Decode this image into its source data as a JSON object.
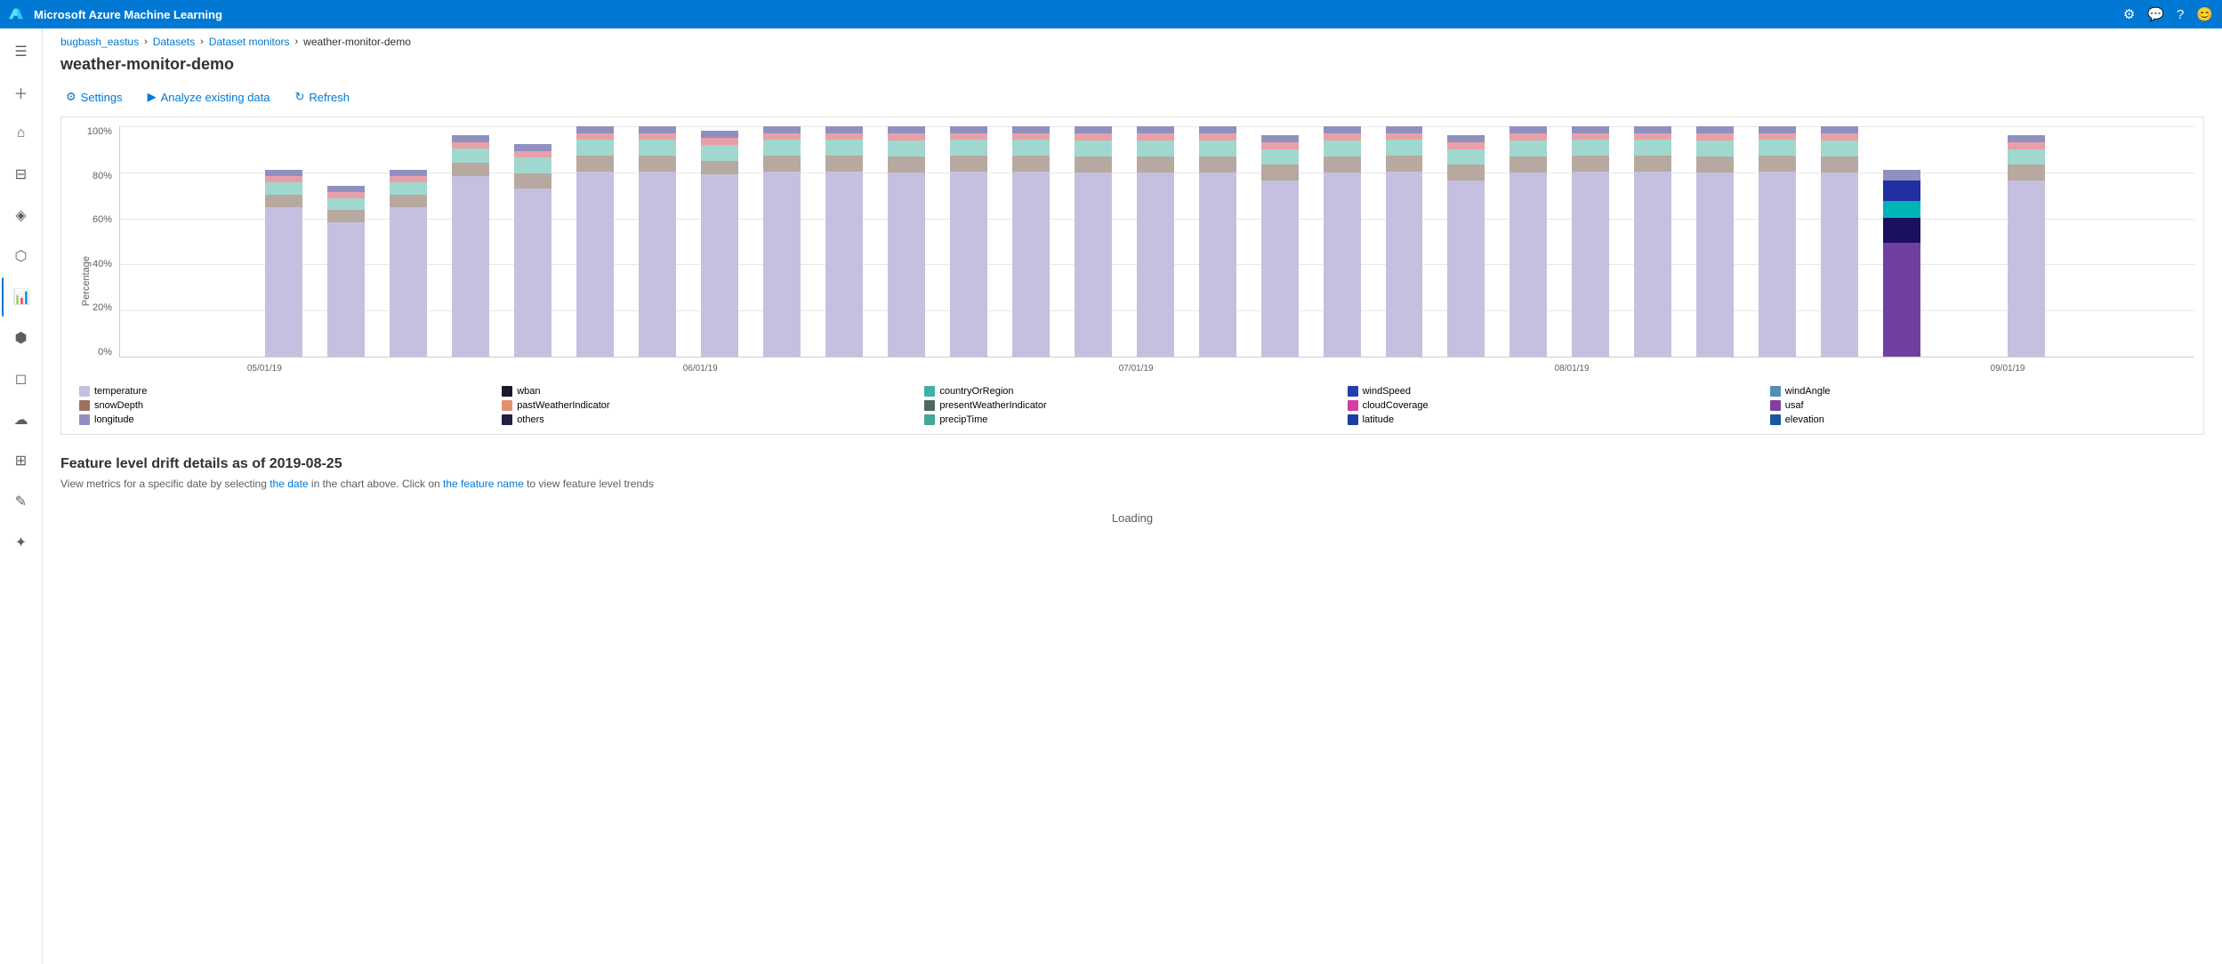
{
  "topbar": {
    "title": "Microsoft Azure Machine Learning",
    "icons": [
      "settings",
      "feedback",
      "help",
      "account"
    ]
  },
  "breadcrumb": {
    "items": [
      "bugbash_eastus",
      "Datasets",
      "Dataset monitors",
      "weather-monitor-demo"
    ]
  },
  "page": {
    "title": "weather-monitor-demo"
  },
  "toolbar": {
    "settings_label": "Settings",
    "analyze_label": "Analyze existing data",
    "refresh_label": "Refresh"
  },
  "chart": {
    "y_labels": [
      "100%",
      "80%",
      "60%",
      "40%",
      "20%",
      "0%"
    ],
    "y_axis_label": "Percentage",
    "x_labels": [
      "05/01/19",
      "06/01/19",
      "07/01/19",
      "08/01/19",
      "09/01/19"
    ],
    "bars": [
      {
        "x": 7,
        "segments": [
          {
            "color": "#c5c0e0",
            "h": 0.72
          },
          {
            "color": "#b8a9a0",
            "h": 0.06
          },
          {
            "color": "#a0d8cf",
            "h": 0.06
          },
          {
            "color": "#e8a0a8",
            "h": 0.03
          },
          {
            "color": "#9090c0",
            "h": 0.03
          }
        ]
      },
      {
        "x": 10,
        "segments": [
          {
            "color": "#c5c0e0",
            "h": 0.68
          },
          {
            "color": "#b8a9a0",
            "h": 0.06
          },
          {
            "color": "#a0d8cf",
            "h": 0.06
          },
          {
            "color": "#e8a0a8",
            "h": 0.03
          },
          {
            "color": "#9090c0",
            "h": 0.03
          }
        ]
      },
      {
        "x": 13,
        "segments": [
          {
            "color": "#c5c0e0",
            "h": 0.72
          },
          {
            "color": "#b8a9a0",
            "h": 0.06
          },
          {
            "color": "#a0d8cf",
            "h": 0.06
          },
          {
            "color": "#e8a0a8",
            "h": 0.03
          },
          {
            "color": "#9090c0",
            "h": 0.03
          }
        ]
      },
      {
        "x": 16,
        "segments": [
          {
            "color": "#c5c0e0",
            "h": 0.8
          },
          {
            "color": "#b8a9a0",
            "h": 0.06
          },
          {
            "color": "#a0d8cf",
            "h": 0.06
          },
          {
            "color": "#e8a0a8",
            "h": 0.03
          },
          {
            "color": "#9090c0",
            "h": 0.03
          }
        ]
      },
      {
        "x": 19,
        "segments": [
          {
            "color": "#c5c0e0",
            "h": 0.76
          },
          {
            "color": "#b8a9a0",
            "h": 0.07
          },
          {
            "color": "#a0d8cf",
            "h": 0.07
          },
          {
            "color": "#e8a0a8",
            "h": 0.03
          },
          {
            "color": "#9090c0",
            "h": 0.03
          }
        ]
      },
      {
        "x": 22,
        "segments": [
          {
            "color": "#c5c0e0",
            "h": 0.82
          },
          {
            "color": "#b8a9a0",
            "h": 0.07
          },
          {
            "color": "#a0d8cf",
            "h": 0.07
          },
          {
            "color": "#e8a0a8",
            "h": 0.03
          },
          {
            "color": "#9090c0",
            "h": 0.03
          }
        ]
      },
      {
        "x": 25,
        "segments": [
          {
            "color": "#c5c0e0",
            "h": 0.82
          },
          {
            "color": "#b8a9a0",
            "h": 0.07
          },
          {
            "color": "#a0d8cf",
            "h": 0.07
          },
          {
            "color": "#e8a0a8",
            "h": 0.03
          },
          {
            "color": "#9090c0",
            "h": 0.03
          }
        ]
      },
      {
        "x": 28,
        "segments": [
          {
            "color": "#c5c0e0",
            "h": 0.8
          },
          {
            "color": "#b8a9a0",
            "h": 0.06
          },
          {
            "color": "#a0d8cf",
            "h": 0.07
          },
          {
            "color": "#e8a0a8",
            "h": 0.03
          },
          {
            "color": "#9090c0",
            "h": 0.03
          }
        ]
      },
      {
        "x": 31,
        "segments": [
          {
            "color": "#c5c0e0",
            "h": 0.82
          },
          {
            "color": "#b8a9a0",
            "h": 0.07
          },
          {
            "color": "#a0d8cf",
            "h": 0.07
          },
          {
            "color": "#e8a0a8",
            "h": 0.03
          },
          {
            "color": "#9090c0",
            "h": 0.03
          }
        ]
      },
      {
        "x": 34,
        "segments": [
          {
            "color": "#c5c0e0",
            "h": 0.82
          },
          {
            "color": "#b8a9a0",
            "h": 0.07
          },
          {
            "color": "#a0d8cf",
            "h": 0.07
          },
          {
            "color": "#e8a0a8",
            "h": 0.03
          },
          {
            "color": "#9090c0",
            "h": 0.03
          }
        ]
      },
      {
        "x": 37,
        "segments": [
          {
            "color": "#c5c0e0",
            "h": 0.8
          },
          {
            "color": "#b8a9a0",
            "h": 0.07
          },
          {
            "color": "#a0d8cf",
            "h": 0.07
          },
          {
            "color": "#e8a0a8",
            "h": 0.03
          },
          {
            "color": "#9090c0",
            "h": 0.03
          }
        ]
      },
      {
        "x": 40,
        "segments": [
          {
            "color": "#c5c0e0",
            "h": 0.82
          },
          {
            "color": "#b8a9a0",
            "h": 0.07
          },
          {
            "color": "#a0d8cf",
            "h": 0.07
          },
          {
            "color": "#e8a0a8",
            "h": 0.03
          },
          {
            "color": "#9090c0",
            "h": 0.03
          }
        ]
      },
      {
        "x": 43,
        "segments": [
          {
            "color": "#c5c0e0",
            "h": 0.82
          },
          {
            "color": "#b8a9a0",
            "h": 0.07
          },
          {
            "color": "#a0d8cf",
            "h": 0.07
          },
          {
            "color": "#e8a0a8",
            "h": 0.03
          },
          {
            "color": "#9090c0",
            "h": 0.03
          }
        ]
      },
      {
        "x": 46,
        "segments": [
          {
            "color": "#c5c0e0",
            "h": 0.8
          },
          {
            "color": "#b8a9a0",
            "h": 0.07
          },
          {
            "color": "#a0d8cf",
            "h": 0.07
          },
          {
            "color": "#e8a0a8",
            "h": 0.03
          },
          {
            "color": "#9090c0",
            "h": 0.03
          }
        ]
      },
      {
        "x": 49,
        "segments": [
          {
            "color": "#c5c0e0",
            "h": 0.8
          },
          {
            "color": "#b8a9a0",
            "h": 0.07
          },
          {
            "color": "#a0d8cf",
            "h": 0.07
          },
          {
            "color": "#e8a0a8",
            "h": 0.03
          },
          {
            "color": "#9090c0",
            "h": 0.03
          }
        ]
      },
      {
        "x": 52,
        "segments": [
          {
            "color": "#c5c0e0",
            "h": 0.8
          },
          {
            "color": "#b8a9a0",
            "h": 0.07
          },
          {
            "color": "#a0d8cf",
            "h": 0.07
          },
          {
            "color": "#e8a0a8",
            "h": 0.03
          },
          {
            "color": "#9090c0",
            "h": 0.03
          }
        ]
      },
      {
        "x": 55,
        "segments": [
          {
            "color": "#c5c0e0",
            "h": 0.78
          },
          {
            "color": "#b8a9a0",
            "h": 0.07
          },
          {
            "color": "#a0d8cf",
            "h": 0.07
          },
          {
            "color": "#e8a0a8",
            "h": 0.03
          },
          {
            "color": "#9090c0",
            "h": 0.03
          }
        ]
      },
      {
        "x": 58,
        "segments": [
          {
            "color": "#c5c0e0",
            "h": 0.8
          },
          {
            "color": "#b8a9a0",
            "h": 0.07
          },
          {
            "color": "#a0d8cf",
            "h": 0.07
          },
          {
            "color": "#e8a0a8",
            "h": 0.03
          },
          {
            "color": "#9090c0",
            "h": 0.03
          }
        ]
      },
      {
        "x": 61,
        "segments": [
          {
            "color": "#c5c0e0",
            "h": 0.82
          },
          {
            "color": "#b8a9a0",
            "h": 0.07
          },
          {
            "color": "#a0d8cf",
            "h": 0.07
          },
          {
            "color": "#e8a0a8",
            "h": 0.03
          },
          {
            "color": "#9090c0",
            "h": 0.03
          }
        ]
      },
      {
        "x": 64,
        "segments": [
          {
            "color": "#c5c0e0",
            "h": 0.78
          },
          {
            "color": "#b8a9a0",
            "h": 0.07
          },
          {
            "color": "#a0d8cf",
            "h": 0.07
          },
          {
            "color": "#e8a0a8",
            "h": 0.03
          },
          {
            "color": "#9090c0",
            "h": 0.03
          }
        ]
      },
      {
        "x": 67,
        "segments": [
          {
            "color": "#c5c0e0",
            "h": 0.8
          },
          {
            "color": "#b8a9a0",
            "h": 0.07
          },
          {
            "color": "#a0d8cf",
            "h": 0.07
          },
          {
            "color": "#e8a0a8",
            "h": 0.03
          },
          {
            "color": "#9090c0",
            "h": 0.03
          }
        ]
      },
      {
        "x": 70,
        "segments": [
          {
            "color": "#c5c0e0",
            "h": 0.82
          },
          {
            "color": "#b8a9a0",
            "h": 0.07
          },
          {
            "color": "#a0d8cf",
            "h": 0.07
          },
          {
            "color": "#e8a0a8",
            "h": 0.03
          },
          {
            "color": "#9090c0",
            "h": 0.03
          }
        ]
      },
      {
        "x": 73,
        "segments": [
          {
            "color": "#c5c0e0",
            "h": 0.82
          },
          {
            "color": "#b8a9a0",
            "h": 0.07
          },
          {
            "color": "#a0d8cf",
            "h": 0.07
          },
          {
            "color": "#e8a0a8",
            "h": 0.03
          },
          {
            "color": "#9090c0",
            "h": 0.03
          }
        ]
      },
      {
        "x": 76,
        "segments": [
          {
            "color": "#c5c0e0",
            "h": 0.8
          },
          {
            "color": "#b8a9a0",
            "h": 0.07
          },
          {
            "color": "#a0d8cf",
            "h": 0.07
          },
          {
            "color": "#e8a0a8",
            "h": 0.03
          },
          {
            "color": "#9090c0",
            "h": 0.03
          }
        ]
      },
      {
        "x": 79,
        "segments": [
          {
            "color": "#c5c0e0",
            "h": 0.82
          },
          {
            "color": "#b8a9a0",
            "h": 0.07
          },
          {
            "color": "#a0d8cf",
            "h": 0.07
          },
          {
            "color": "#e8a0a8",
            "h": 0.03
          },
          {
            "color": "#9090c0",
            "h": 0.03
          }
        ]
      },
      {
        "x": 82,
        "segments": [
          {
            "color": "#c5c0e0",
            "h": 0.8
          },
          {
            "color": "#b8a9a0",
            "h": 0.07
          },
          {
            "color": "#a0d8cf",
            "h": 0.07
          },
          {
            "color": "#e8a0a8",
            "h": 0.03
          },
          {
            "color": "#9090c0",
            "h": 0.03
          }
        ]
      },
      {
        "x": 85,
        "segments": [
          {
            "color": "#7040a0",
            "h": 0.55
          },
          {
            "color": "#1a1060",
            "h": 0.12
          },
          {
            "color": "#00b4b4",
            "h": 0.08
          },
          {
            "color": "#2030a0",
            "h": 0.1
          },
          {
            "color": "#9090c0",
            "h": 0.05
          }
        ]
      },
      {
        "x": 91,
        "segments": [
          {
            "color": "#c5c0e0",
            "h": 0.78
          },
          {
            "color": "#b8a9a0",
            "h": 0.07
          },
          {
            "color": "#a0d8cf",
            "h": 0.07
          },
          {
            "color": "#e8a0a8",
            "h": 0.03
          },
          {
            "color": "#9090c0",
            "h": 0.03
          }
        ]
      }
    ]
  },
  "legend": {
    "items": [
      {
        "label": "temperature",
        "color": "#c5bfe0"
      },
      {
        "label": "wban",
        "color": "#1a1a2e"
      },
      {
        "label": "countryOrRegion",
        "color": "#40b0a8"
      },
      {
        "label": "windSpeed",
        "color": "#2040b0"
      },
      {
        "label": "windAngle",
        "color": "#5090b8"
      },
      {
        "label": "snowDepth",
        "color": "#a07060"
      },
      {
        "label": "pastWeatherIndicator",
        "color": "#e09070"
      },
      {
        "label": "presentWeatherIndicator",
        "color": "#506858"
      },
      {
        "label": "cloudCoverage",
        "color": "#d040a0"
      },
      {
        "label": "usaf",
        "color": "#8040a0"
      },
      {
        "label": "longitude",
        "color": "#9090c0"
      },
      {
        "label": "others",
        "color": "#202040"
      },
      {
        "label": "precipTime",
        "color": "#40a898"
      },
      {
        "label": "latitude",
        "color": "#1840a0"
      },
      {
        "label": "elevation",
        "color": "#1858a0"
      }
    ]
  },
  "drift_section": {
    "title": "Feature level drift details as of 2019-08-25",
    "subtitle": "View metrics for a specific date by selecting the date in the chart above. Click on the feature name to view feature level trends",
    "loading": "Loading"
  },
  "sidebar": {
    "items": [
      {
        "icon": "☰",
        "name": "menu"
      },
      {
        "icon": "+",
        "name": "create"
      },
      {
        "icon": "⌂",
        "name": "home"
      },
      {
        "icon": "≡",
        "name": "dashboard"
      },
      {
        "icon": "◈",
        "name": "assets"
      },
      {
        "icon": "⬡",
        "name": "models"
      },
      {
        "icon": "⚙",
        "name": "datasets",
        "active": true
      },
      {
        "icon": "⬢",
        "name": "pipelines"
      },
      {
        "icon": "◻",
        "name": "endpoints"
      },
      {
        "icon": "☁",
        "name": "compute"
      },
      {
        "icon": "⊞",
        "name": "environments"
      },
      {
        "icon": "✎",
        "name": "notebooks"
      },
      {
        "icon": "✦",
        "name": "automl"
      }
    ]
  }
}
